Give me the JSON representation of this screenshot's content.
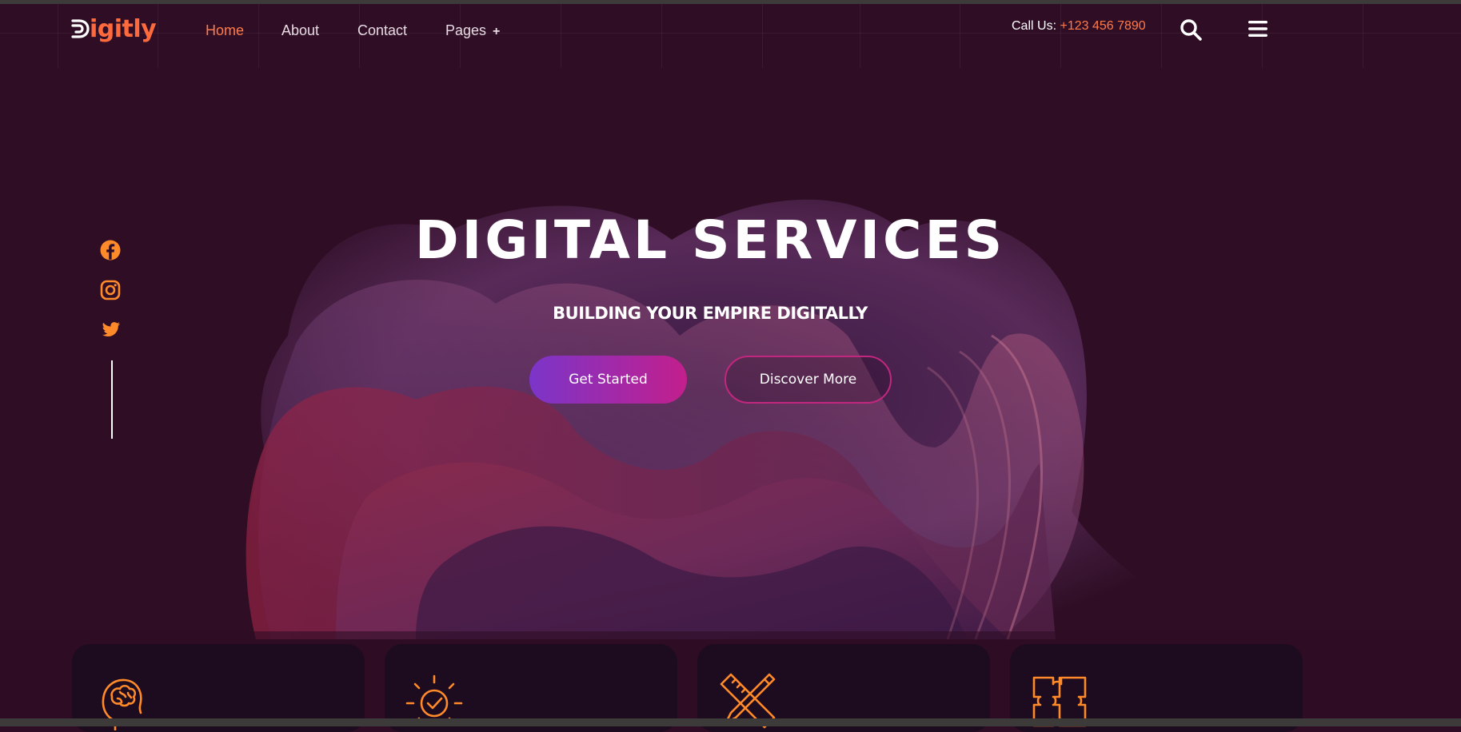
{
  "brand": {
    "logo_text": "igitly",
    "logo_mark": "D",
    "accent": "#ff6a3d"
  },
  "nav": {
    "items": [
      {
        "label": "Home",
        "active": true
      },
      {
        "label": "About",
        "active": false
      },
      {
        "label": "Contact",
        "active": false
      },
      {
        "label": "Pages",
        "active": false,
        "has_submenu": true
      }
    ],
    "submenu_glyph": "+"
  },
  "contact": {
    "call_label": "Call Us:",
    "phone": "+123 456 7890"
  },
  "header_icons": [
    "search-icon",
    "menu-icon"
  ],
  "social": [
    "facebook-icon",
    "instagram-icon",
    "twitter-icon"
  ],
  "hero": {
    "title": "DIGITAL SERVICES",
    "subtitle": "BUILDING YOUR EMPIRE DIGITALLY",
    "primary_button": "Get Started",
    "secondary_button": "Discover More"
  },
  "service_cards": [
    {
      "icon": "brain-head-icon"
    },
    {
      "icon": "idea-check-icon"
    },
    {
      "icon": "ruler-pencil-icon"
    },
    {
      "icon": "puzzle-icon"
    }
  ],
  "colors": {
    "background": "#2f0e25",
    "accent_orange": "#ff7a4a",
    "button_gradient_start": "#7b35c9",
    "button_gradient_end": "#c31f8c",
    "outline_border": "#c2277f",
    "card_bg": "#1d0b1f"
  }
}
